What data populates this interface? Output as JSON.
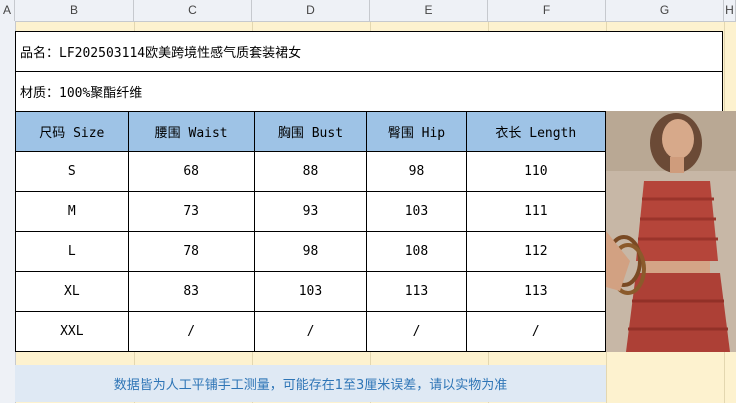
{
  "columns": [
    "A",
    "B",
    "C",
    "D",
    "E",
    "F",
    "G",
    "H"
  ],
  "product_line": "品名：LF202503114欧美跨境性感气质套装裙女",
  "material_line": "材质：100%聚酯纤维",
  "table": {
    "headers": [
      "尺码 Size",
      "腰围 Waist",
      "胸围 Bust",
      "臀围 Hip",
      "衣长 Length"
    ],
    "rows": [
      [
        "S",
        "68",
        "88",
        "98",
        "110"
      ],
      [
        "M",
        "73",
        "93",
        "103",
        "111"
      ],
      [
        "L",
        "78",
        "98",
        "108",
        "112"
      ],
      [
        "XL",
        "83",
        "103",
        "113",
        "113"
      ],
      [
        "XXL",
        "/",
        "/",
        "/",
        "/"
      ]
    ]
  },
  "note": "数据皆为人工平铺手工测量，可能存在1至3厘米误差，请以实物为准",
  "colors": {
    "header_fill": "#9ec3e6",
    "sheet_fill": "#fdf2cf",
    "note_fill": "#dfe9f4",
    "note_text": "#2e75b6"
  }
}
